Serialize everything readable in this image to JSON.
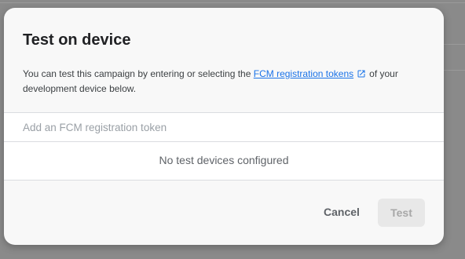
{
  "dialog": {
    "title": "Test on device",
    "description_before": "You can test this campaign by entering or selecting the",
    "link_text": "FCM registration tokens",
    "description_after": "of your development device below.",
    "token_placeholder": "Add an FCM registration token",
    "empty_state": "No test devices configured",
    "cancel_label": "Cancel",
    "test_label": "Test"
  },
  "colors": {
    "link": "#1a73e8",
    "disabled_button_bg": "#e8e8e8",
    "disabled_button_text": "#a8a8a8"
  },
  "icons": {
    "external_link": "external-link-icon"
  }
}
